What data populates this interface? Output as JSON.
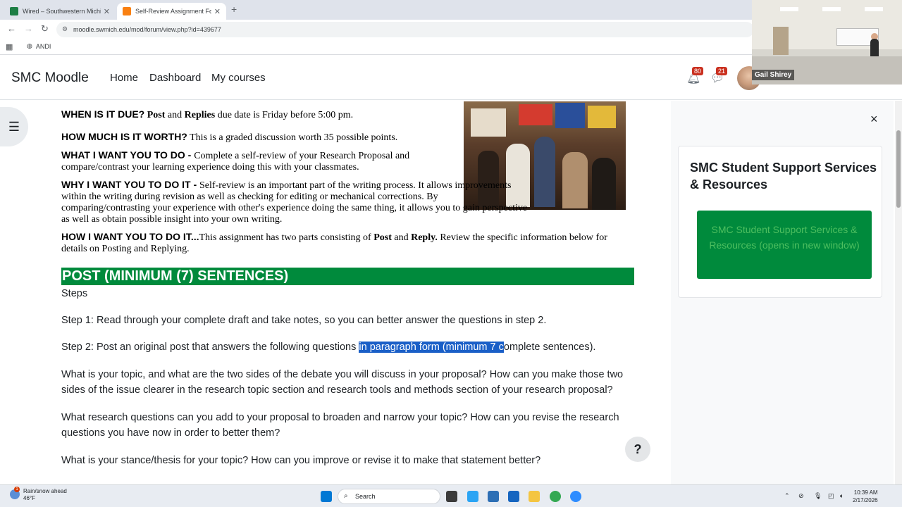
{
  "browser": {
    "tabs": [
      {
        "title": "Wired – Southwestern Michiga...",
        "active": false,
        "favicon_color": "#1e7e45"
      },
      {
        "title": "Self-Review Assignment Forum",
        "active": true,
        "favicon_color": "#f98012"
      }
    ],
    "new_tab": "+",
    "url": "moodle.swmich.edu/mod/forum/view.php?id=439677",
    "bookmarks": [
      {
        "label": "ANDI"
      }
    ]
  },
  "navbar": {
    "brand": "SMC Moodle",
    "links": [
      "Home",
      "Dashboard",
      "My courses"
    ],
    "notifications_count": "80",
    "messages_count": "21"
  },
  "video": {
    "participant_name": "Gail Shirey"
  },
  "content": {
    "due_label": "WHEN IS IT DUE?",
    "due_text_post": "Post",
    "due_text_and": " and ",
    "due_text_replies": "Replies",
    "due_text_rest": " due date is Friday before 5:00 pm.",
    "worth_label": "HOW MUCH IS IT WORTH?",
    "worth_text": "  This is a graded discussion worth 35 possible points.",
    "todo_label": "WHAT I WANT YOU TO DO - ",
    "todo_text": "Complete a self-review of your Research Proposal and compare/contrast your learning experience doing this with your classmates.",
    "why_label": "WHY I WANT YOU TO DO IT - ",
    "why_text": "Self-review is an important part of the writing process.  It allows improvements within the writing during revision as well as checking for editing or mechanical corrections. By comparing/contrasting your experience with other's experience doing the same thing, it allows you to gain perspective as well as obtain possible insight into your own writing.",
    "how_label": "HOW I WANT YOU TO DO IT...",
    "how_text_1": "This assignment has two parts consisting of ",
    "how_post": "Post",
    "how_and": " and ",
    "how_reply": "Reply.",
    "how_text_2": "  Review the specific information below for details on Posting and Replying.",
    "banner": "POST (MINIMUM (7) SENTENCES)",
    "steps_heading": "Steps",
    "step1": "Step 1: Read through your complete draft and take notes, so you can better answer the questions in step 2.",
    "step2_before": "Step 2: Post an original post that answers the following questions ",
    "step2_highlight": "in paragraph form (minimum 7 c",
    "step2_after": "omplete sentences).",
    "q1": "What is your topic, and what are the two sides of the debate you will discuss in your proposal? How can you make those two sides of the issue clearer in the research topic section and research tools and methods section of your research proposal?",
    "q2": "What research questions can you add to your proposal to broaden and narrow your topic? How can you revise the research questions you have now in order to better them?",
    "q3": "What is your stance/thesis for your topic? How can you improve or revise it to make that statement better?"
  },
  "help_button": "?",
  "drawer": {
    "close": "×",
    "card_title": "SMC Student Support Services & Resources",
    "card_button": "SMC Student Support Services & Resources (opens in new window)"
  },
  "taskbar": {
    "weather_title": "Rain/snow ahead",
    "weather_temp": "46°F",
    "weather_badge": "1",
    "search_placeholder": "Search",
    "time": "10:39 AM",
    "date": "2/17/2026"
  }
}
